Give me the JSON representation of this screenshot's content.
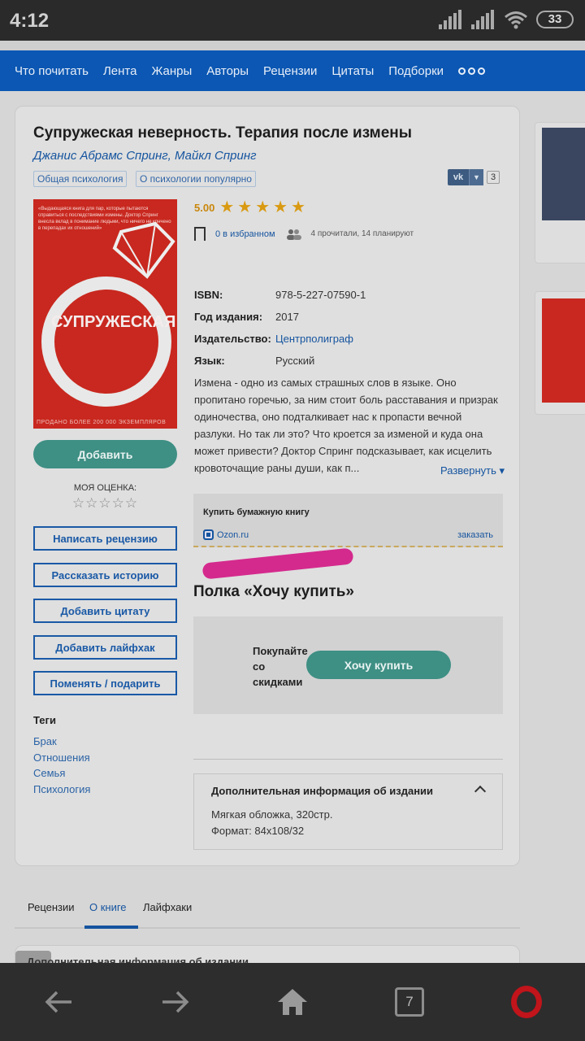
{
  "status_bar": {
    "time": "4:12",
    "battery": "33"
  },
  "nav": {
    "items": [
      "Что почитать",
      "Лента",
      "Жанры",
      "Авторы",
      "Рецензии",
      "Цитаты",
      "Подборки"
    ]
  },
  "book": {
    "title": "Супружеская неверность. Терапия после измены",
    "authors": "Джанис Абрамс Спринг, Майкл Спринг",
    "genres": [
      "Общая психология",
      "О психологии популярно"
    ],
    "share_count": "3",
    "rating": "5.00",
    "favorites_label": "0 в избранном",
    "readers": "4 прочитали, 14 планируют",
    "cover": {
      "blurb": "«Выдающаяся книга для пар, которые пытаются справиться с последствиями измены. Доктор Спринг внесла вклад в понимание людьми, что ничего не кончено в перепадах их отношений»",
      "title": "СУПРУЖЕСКАЯ",
      "bottom_text": "ПРОДАНО БОЛЕЕ 200 000 ЭКЗЕМПЛЯРОВ"
    },
    "details": [
      {
        "key": "ISBN:",
        "value": "978-5-227-07590-1",
        "link": false
      },
      {
        "key": "Год издания:",
        "value": "2017",
        "link": false
      },
      {
        "key": "Издательство:",
        "value": "Центрполиграф",
        "link": true
      },
      {
        "key": "Язык:",
        "value": "Русский",
        "link": false
      }
    ],
    "description": "Измена - одно из самых страшных слов в языке. Оно пропитано горечью, за ним стоит боль расставания и призрак одиночества, оно подталкивает нас к пропасти вечной разлуки. Но так ли это? Что кроется за изменой и куда она может привести? Доктор Спринг подсказывает, как исцелить кровоточащие раны души, как п...",
    "expand_label": "Развернуть ▾"
  },
  "left_actions": {
    "add_button": "Добавить",
    "my_rating_label": "МОЯ ОЦЕНКА:",
    "my_rating_stars": "☆☆☆☆☆",
    "buttons": [
      "Написать рецензию",
      "Рассказать историю",
      "Добавить цитату",
      "Добавить лайфхак",
      "Поменять / подарить"
    ]
  },
  "tags": {
    "heading": "Теги",
    "items": [
      "Брак",
      "Отношения",
      "Семья",
      "Психология"
    ]
  },
  "buy": {
    "heading": "Купить бумажную книгу",
    "store": "Ozon.ru",
    "order": "заказать"
  },
  "shelf": {
    "title": "Полка «Хочу купить»",
    "promo": "Покупайте со скидками",
    "button": "Хочу купить"
  },
  "additional": {
    "heading": "Дополнительная информация об издании",
    "binding": "Мягкая обложка, 320стр.",
    "format": "Формат: 84x108/32"
  },
  "tabs": [
    "Рецензии",
    "О книге",
    "Лайфхаки"
  ],
  "bottom_card": {
    "text": "Дополнительная информация об издании"
  },
  "browser": {
    "tab_count": "7"
  },
  "colors": {
    "nav": "#0b57b3",
    "accent_green": "#3e8f84",
    "link": "#15549f",
    "opera": "#c1141b",
    "highlighter": "#d42a8d"
  }
}
